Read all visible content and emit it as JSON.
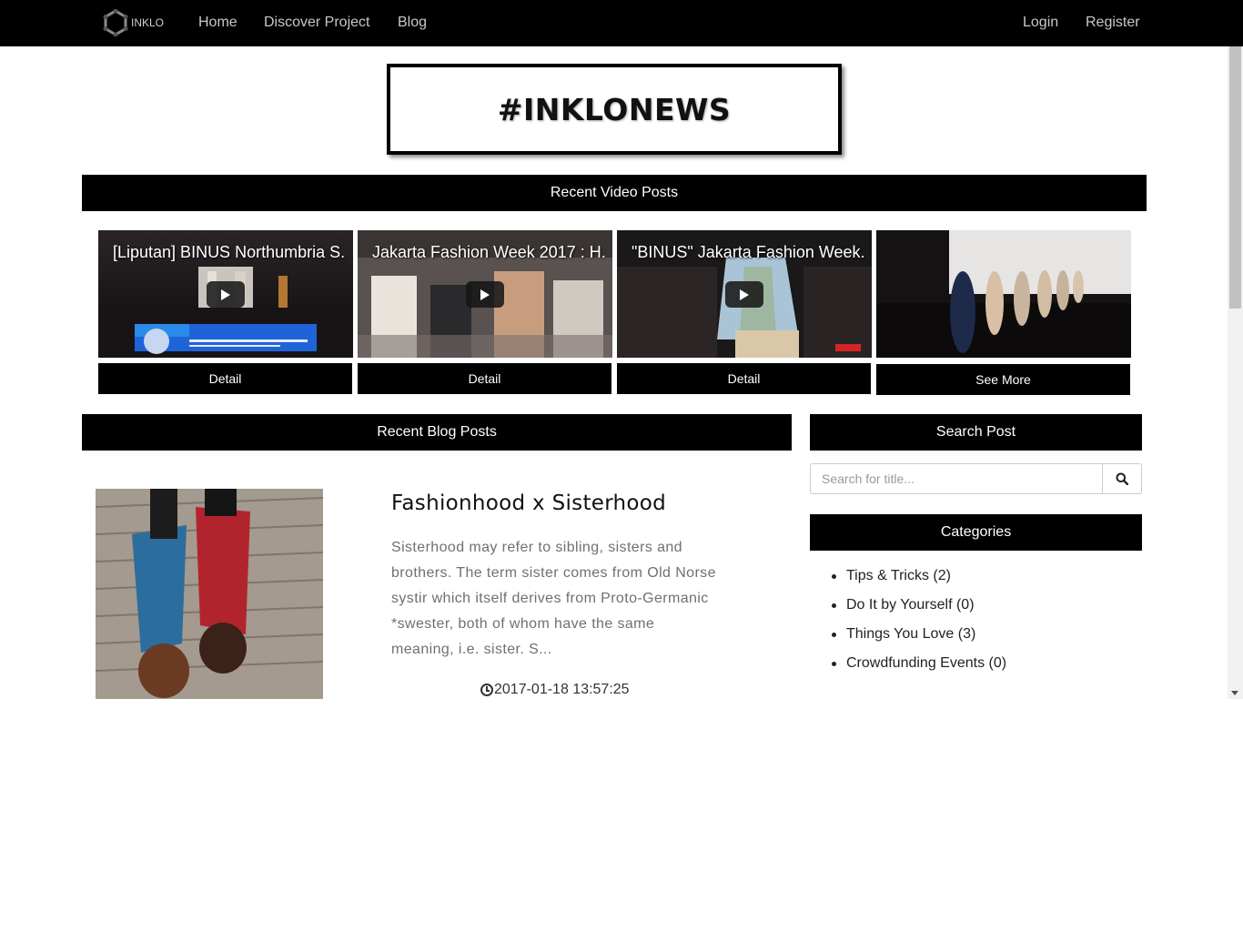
{
  "nav": {
    "logo_text": "INKLO",
    "links": [
      "Home",
      "Discover Project",
      "Blog"
    ],
    "login": "Login",
    "register": "Register"
  },
  "hero": {
    "title": "#INKLONEWS"
  },
  "videos": {
    "section_title": "Recent Video Posts",
    "items": [
      {
        "title": "[Liputan] BINUS Northumbria S..",
        "button": "Detail"
      },
      {
        "title": "Jakarta Fashion Week 2017 : H..",
        "button": "Detail"
      },
      {
        "title": "\"BINUS\" Jakarta Fashion Week..",
        "button": "Detail"
      }
    ],
    "see_more": "See More"
  },
  "blog": {
    "section_title": "Recent Blog Posts",
    "post": {
      "title": "Fashionhood x Sisterhood",
      "excerpt": "Sisterhood may refer to sibling, sisters and brothers. The term sister comes from Old Norse systir which itself derives from Proto-Germanic *swester, both of whom have the same meaning, i.e. sister. S...",
      "date": "2017-01-18 13:57:25"
    }
  },
  "sidebar": {
    "search_title": "Search Post",
    "search_placeholder": "Search for title...",
    "categories_title": "Categories",
    "categories": [
      "Tips & Tricks (2)",
      "Do It by Yourself (0)",
      "Things You Love (3)",
      "Crowdfunding Events (0)"
    ]
  },
  "icons": {
    "logo": "inklo-logo-icon",
    "play": "play-icon",
    "search": "search-icon",
    "clock": "clock-icon"
  }
}
